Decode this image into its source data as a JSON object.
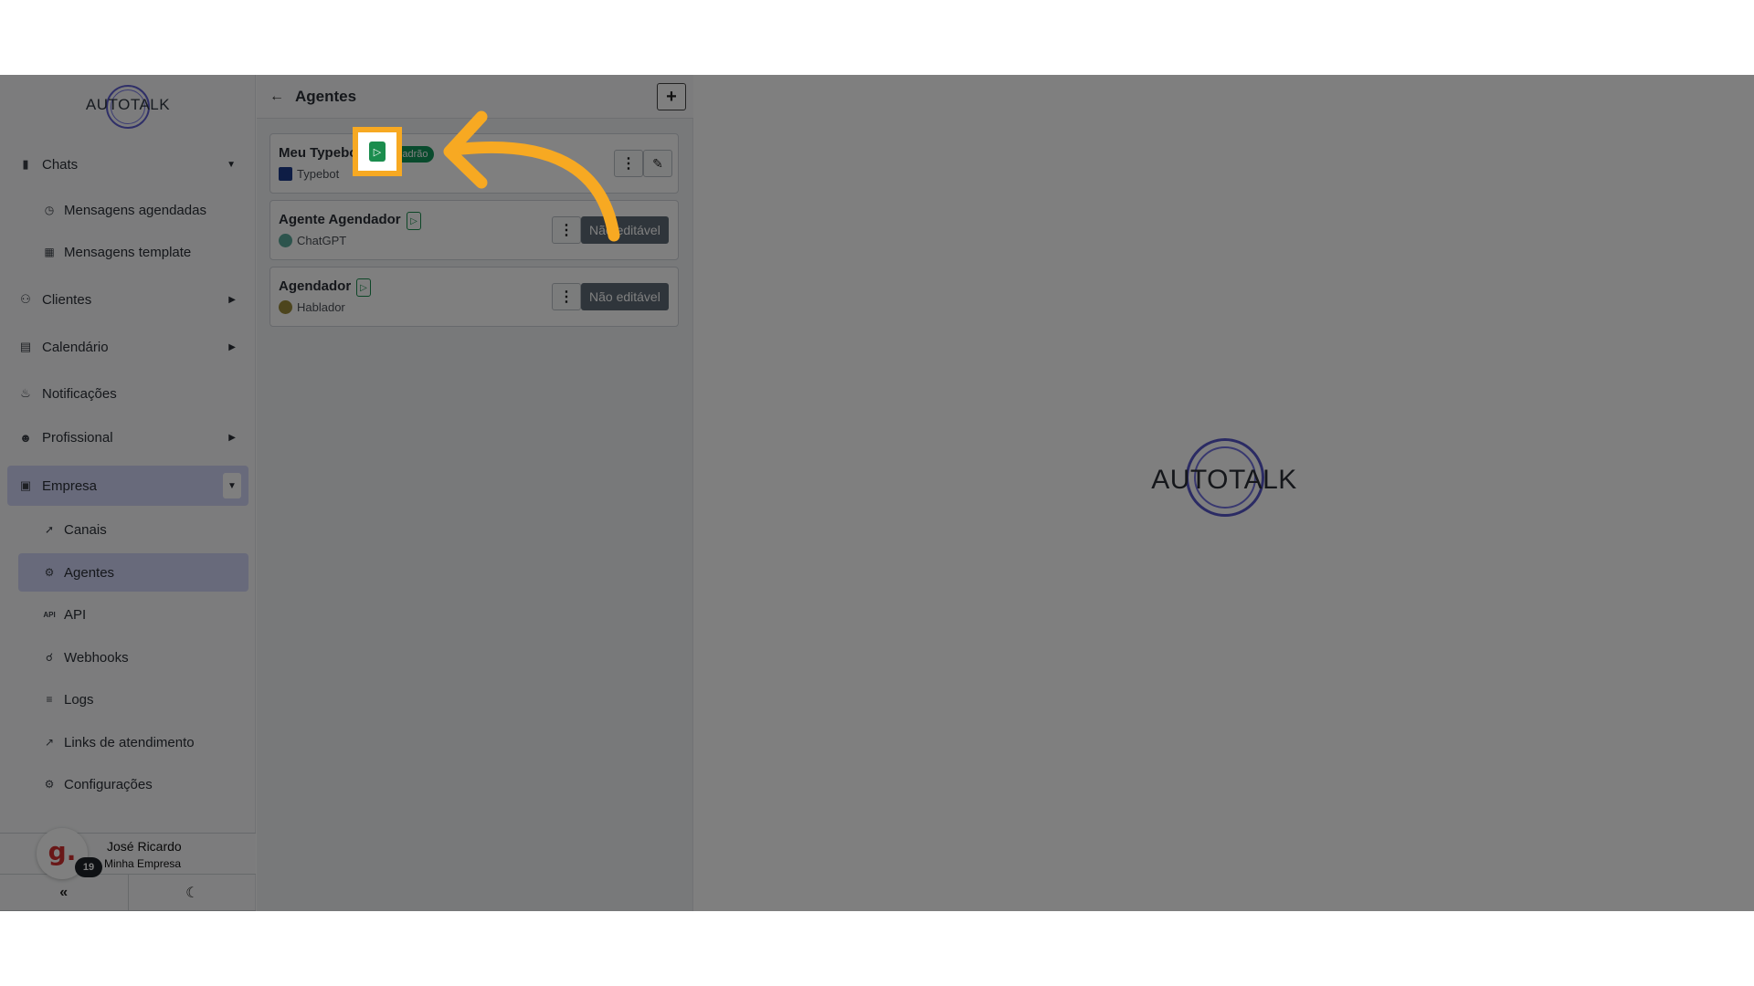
{
  "brand": {
    "name": "AUTOTALK"
  },
  "sidebar": {
    "items": [
      {
        "label": "Chats",
        "icon": "chat-icon"
      },
      {
        "label": "Mensagens agendadas",
        "icon": "clock-icon"
      },
      {
        "label": "Mensagens template",
        "icon": "template-icon"
      },
      {
        "label": "Clientes",
        "icon": "users-icon"
      },
      {
        "label": "Calendário",
        "icon": "calendar-icon"
      },
      {
        "label": "Notificações",
        "icon": "bell-icon"
      },
      {
        "label": "Profissional",
        "icon": "user-tie-icon"
      },
      {
        "label": "Empresa",
        "icon": "building-icon"
      },
      {
        "label": "Canais",
        "icon": "rocket-icon"
      },
      {
        "label": "Agentes",
        "icon": "robot-icon"
      },
      {
        "label": "API",
        "icon": "api-icon"
      },
      {
        "label": "Webhooks",
        "icon": "webhook-icon"
      },
      {
        "label": "Logs",
        "icon": "list-icon"
      },
      {
        "label": "Links de atendimento",
        "icon": "external-link-icon"
      },
      {
        "label": "Configurações",
        "icon": "gear-icon"
      }
    ],
    "active_item": "Agentes"
  },
  "user": {
    "name": "José Ricardo",
    "company": "Minha Empresa",
    "avatar_letter": "g.",
    "badge_count": "19"
  },
  "panel": {
    "title": "Agentes",
    "agents": [
      {
        "name": "Meu Typebot",
        "provider": "Typebot",
        "tag": "Padrão",
        "action": "edit"
      },
      {
        "name": "Agente Agendador",
        "provider": "ChatGPT",
        "action_label": "Não editável"
      },
      {
        "name": "Agendador",
        "provider": "Hablador",
        "action_label": "Não editável"
      }
    ]
  },
  "colors": {
    "accent": "#d0d4f7",
    "highlight": "#f7a922",
    "success": "#13965a",
    "logo_ring": "#5656c8"
  }
}
